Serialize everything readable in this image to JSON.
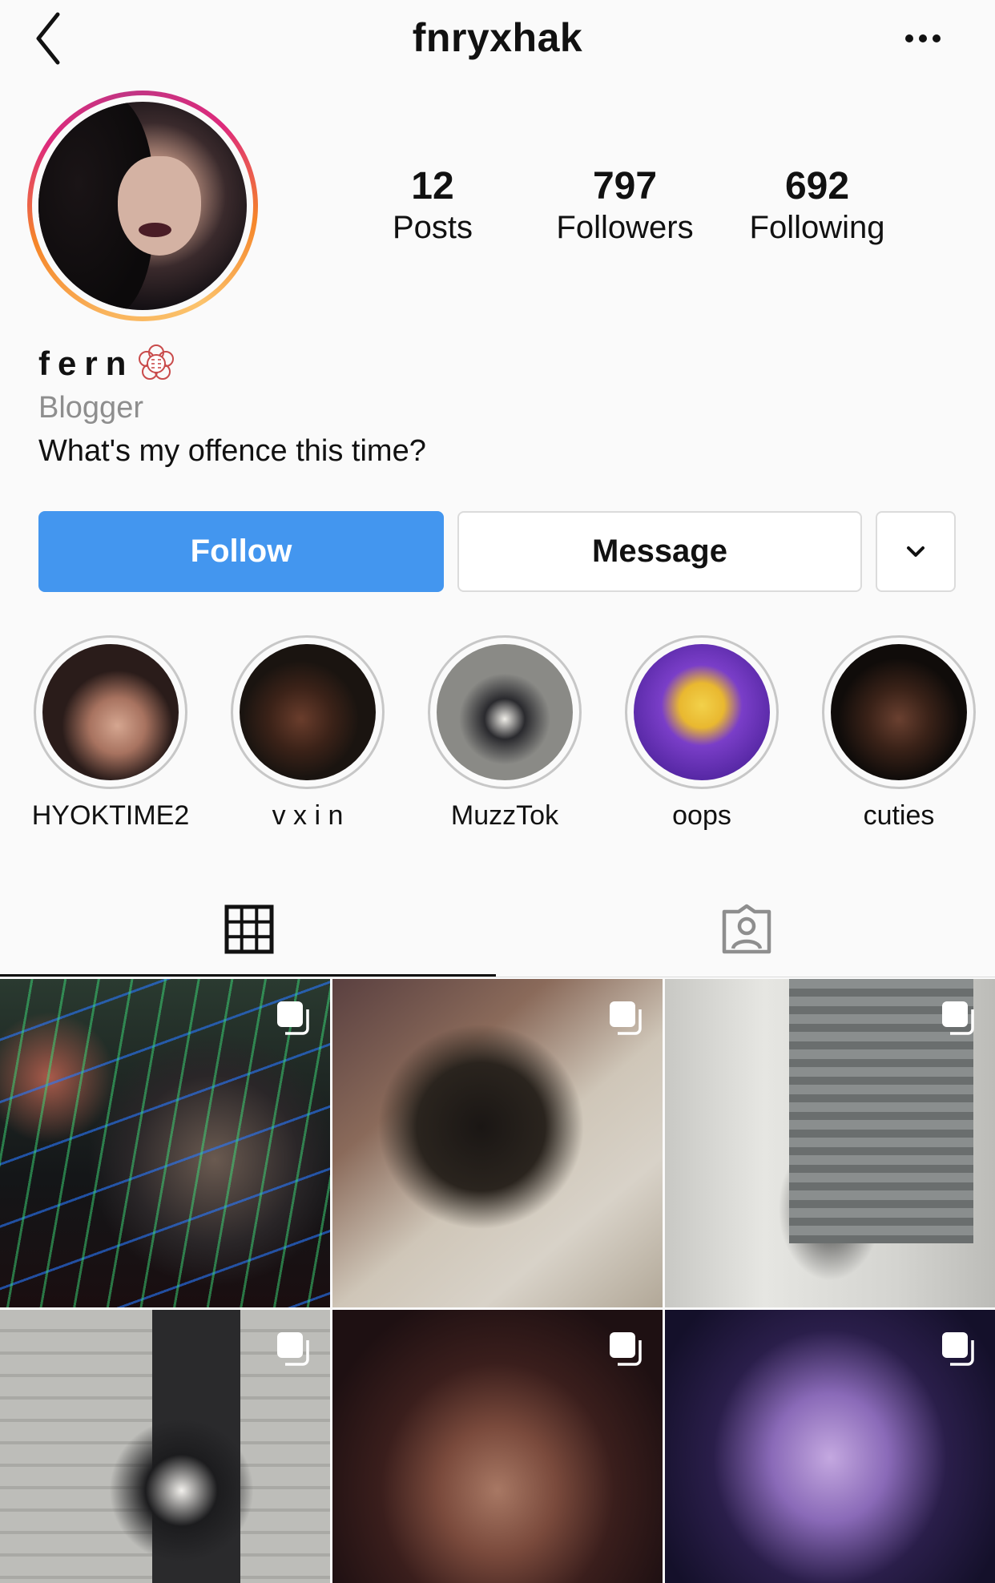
{
  "header": {
    "username": "fnryxhak",
    "back_icon": "chevron-left-icon",
    "more_icon": "ellipsis-icon"
  },
  "stats": {
    "posts": {
      "count": "12",
      "label": "Posts"
    },
    "followers": {
      "count": "797",
      "label": "Followers"
    },
    "following": {
      "count": "692",
      "label": "Following"
    }
  },
  "bio": {
    "name": "fern",
    "category": "Blogger",
    "text": "What's my offence this time?"
  },
  "actions": {
    "follow_label": "Follow",
    "message_label": "Message",
    "dropdown_icon": "chevron-down-icon"
  },
  "highlights": [
    {
      "label": "HYOKTIME2"
    },
    {
      "label": "v x i n"
    },
    {
      "label": "MuzzTok"
    },
    {
      "label": "oops"
    },
    {
      "label": "cuties"
    }
  ],
  "tabs": [
    {
      "icon": "grid-icon",
      "active": true
    },
    {
      "icon": "tagged-icon",
      "active": false
    }
  ],
  "colors": {
    "follow_button": "#4396ef",
    "border": "#dbdbdb",
    "secondary_text": "#8e8e8e"
  }
}
